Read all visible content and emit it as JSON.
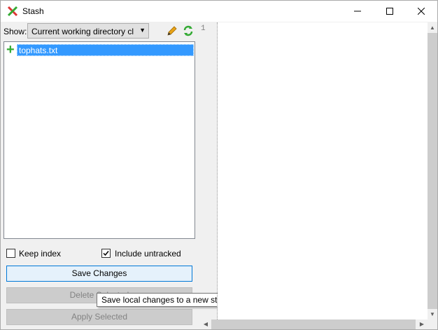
{
  "window": {
    "title": "Stash"
  },
  "toolbar": {
    "show_label": "Show:",
    "show_value": "Current working directory cl"
  },
  "files": [
    {
      "name": "tophats.txt",
      "status": "added"
    }
  ],
  "options": {
    "keep_index_label": "Keep index",
    "keep_index_checked": false,
    "include_untracked_label": "Include untracked",
    "include_untracked_checked": true
  },
  "buttons": {
    "save": "Save Changes",
    "delete": "Delete Selected",
    "apply": "Apply Selected"
  },
  "tooltip": "Save local changes to a new stash, then revert local changes",
  "editor": {
    "line_number": "1"
  }
}
